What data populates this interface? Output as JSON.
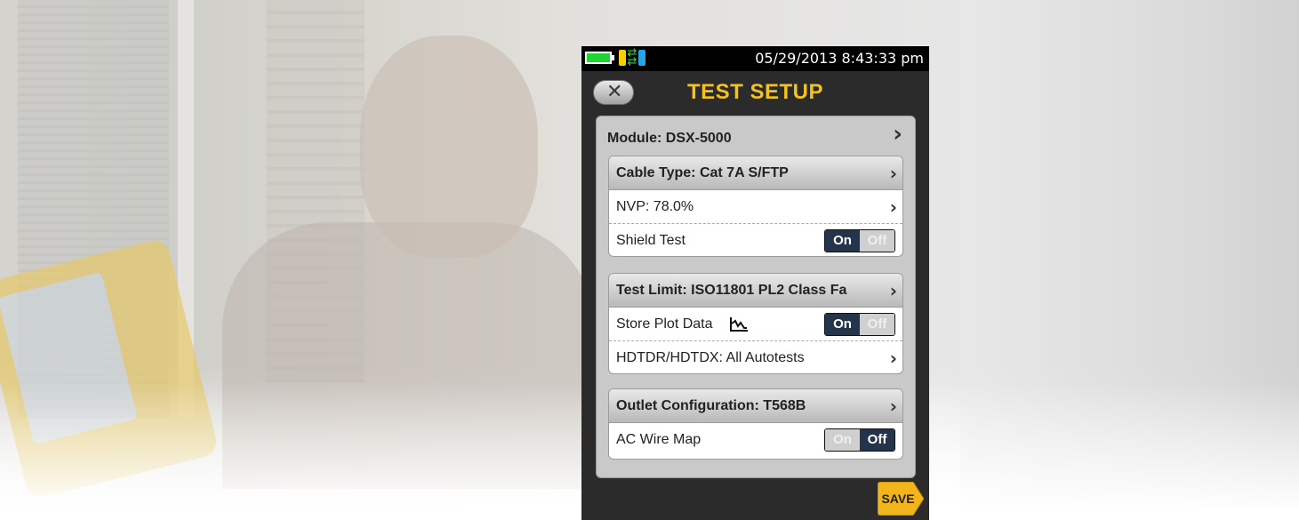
{
  "status_bar": {
    "datetime": "05/29/2013 8:43:33 pm",
    "battery_color": "#21d334"
  },
  "header": {
    "title": "TEST SETUP",
    "back_icon": "close-x-icon"
  },
  "module": {
    "label": "Module: DSX-5000"
  },
  "cable_group": {
    "header": "Cable Type: Cat 7A S/FTP",
    "nvp_label": "NVP: 78.0%",
    "shield_label": "Shield Test",
    "shield_toggle": {
      "on": "On",
      "off": "Off",
      "value": "On"
    }
  },
  "limit_group": {
    "header": "Test Limit: ISO11801 PL2 Class Fa",
    "store_plot_label": "Store Plot Data",
    "store_plot_icon": "plot-graph-icon",
    "store_plot_toggle": {
      "on": "On",
      "off": "Off",
      "value": "On"
    },
    "hdtdr_label": "HDTDR/HDTDX: All Autotests"
  },
  "outlet_group": {
    "header": "Outlet Configuration: T568B",
    "ac_wire_label": "AC Wire Map",
    "ac_wire_toggle": {
      "on": "On",
      "off": "Off",
      "value": "Off"
    }
  },
  "footer": {
    "save_label": "SAVE"
  },
  "colors": {
    "title": "#f3c21b",
    "toggle_active": "#24344a",
    "save_button": "#f2b61c"
  }
}
